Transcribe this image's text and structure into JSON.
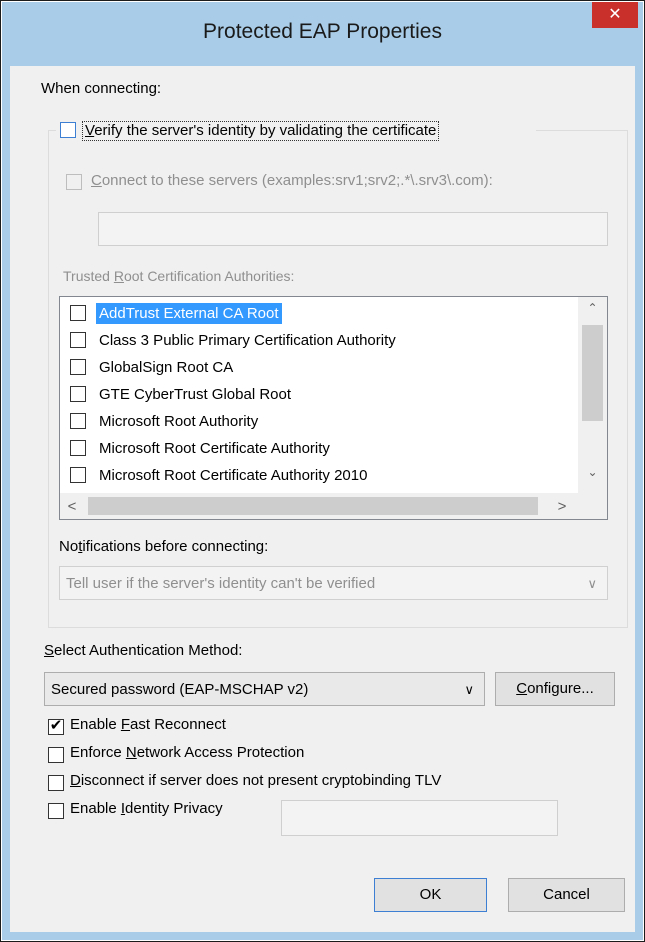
{
  "window": {
    "title": "Protected EAP Properties",
    "close_glyph": "✕"
  },
  "when_connecting": {
    "label": "When connecting:"
  },
  "verify_identity": {
    "checked": false,
    "label_first": "V",
    "label_rest": "erify the server's identity by validating the certificate"
  },
  "connect_servers": {
    "checked": false,
    "label_first": "C",
    "label_rest": "onnect to these servers (examples:srv1;srv2;.*\\.srv3\\.com):",
    "value": ""
  },
  "trusted_root": {
    "label_pre": "Trusted ",
    "label_ul": "R",
    "label_post": "oot Certification Authorities:",
    "items": [
      {
        "label": "AddTrust External CA Root",
        "checked": false,
        "selected": true
      },
      {
        "label": "Class 3 Public Primary Certification Authority",
        "checked": false,
        "selected": false
      },
      {
        "label": "GlobalSign Root CA",
        "checked": false,
        "selected": false
      },
      {
        "label": "GTE CyberTrust Global Root",
        "checked": false,
        "selected": false
      },
      {
        "label": "Microsoft Root Authority",
        "checked": false,
        "selected": false
      },
      {
        "label": "Microsoft Root Certificate Authority",
        "checked": false,
        "selected": false
      },
      {
        "label": "Microsoft Root Certificate Authority 2010",
        "checked": false,
        "selected": false
      }
    ],
    "scroll_up": "⌃",
    "scroll_down": "⌄",
    "scroll_left": "<",
    "scroll_right": ">"
  },
  "notifications": {
    "label_pre": "No",
    "label_ul": "t",
    "label_post": "ifications before connecting:",
    "selected": "Tell user if the server's identity can't be verified",
    "chevron": "∨"
  },
  "auth_method": {
    "label_first": "S",
    "label_rest": "elect Authentication Method:",
    "selected": "Secured password (EAP-MSCHAP v2)",
    "chevron": "∨",
    "configure_first": "C",
    "configure_rest": "onfigure..."
  },
  "options": [
    {
      "pre": "Enable ",
      "ul": "F",
      "post": "ast Reconnect",
      "checked": true
    },
    {
      "pre": "Enforce ",
      "ul": "N",
      "post": "etwork Access Protection",
      "checked": false
    },
    {
      "pre": "",
      "ul": "D",
      "post": "isconnect if server does not present cryptobinding TLV",
      "checked": false
    },
    {
      "pre": "Enable ",
      "ul": "I",
      "post": "dentity Privacy",
      "checked": false
    }
  ],
  "identity_privacy_value": "",
  "buttons": {
    "ok": "OK",
    "cancel": "Cancel"
  },
  "check_glyph": "✔",
  "colors": {
    "frame": "#a9cde8",
    "close": "#c9302c",
    "selection": "#3399ff",
    "focus": "#3c7fd3"
  }
}
